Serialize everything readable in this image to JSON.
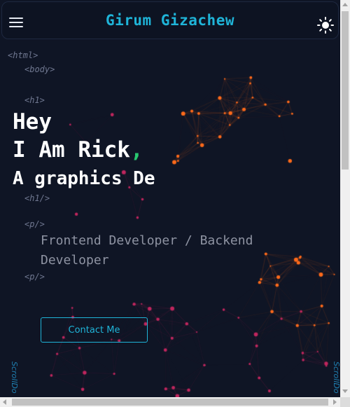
{
  "header": {
    "title": "Girum Gizachew",
    "menu_icon": "hamburger-menu-icon",
    "theme_icon": "sun-icon"
  },
  "tags": {
    "html_open": "<html>",
    "body_open": "<body>",
    "h1_open": "<h1>",
    "h1_close": "<h1/>",
    "p_open": "<p/>",
    "p_close": "<p/>"
  },
  "hero": {
    "line1": "Hey",
    "line2": "I Am Rick",
    "line2_comma": ",",
    "line3": "A graphics De"
  },
  "description": "Frontend Developer / Backend Developer",
  "contact_button": "Contact Me",
  "scroll_left": "ScrollDo",
  "scroll_right": "ScrollDo",
  "colors": {
    "background": "#0f1525",
    "accent": "#1fb4d8",
    "comma": "#28c76f",
    "node_orange": "#ff6a1a",
    "node_magenta": "#c0265e"
  }
}
